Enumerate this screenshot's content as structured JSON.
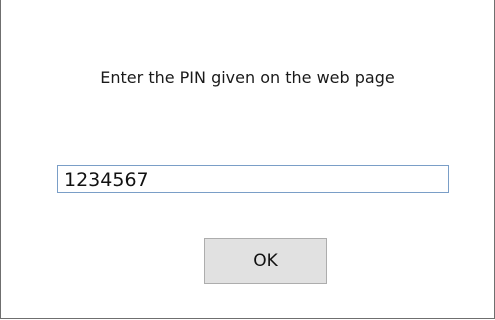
{
  "dialog": {
    "prompt": "Enter the PIN given on the web page",
    "pin_value": "1234567",
    "ok_label": "OK"
  },
  "colors": {
    "input_border": "#7a9ec7",
    "button_bg": "#e1e1e1",
    "button_border": "#adadad",
    "window_border": "#6f6f6f"
  }
}
